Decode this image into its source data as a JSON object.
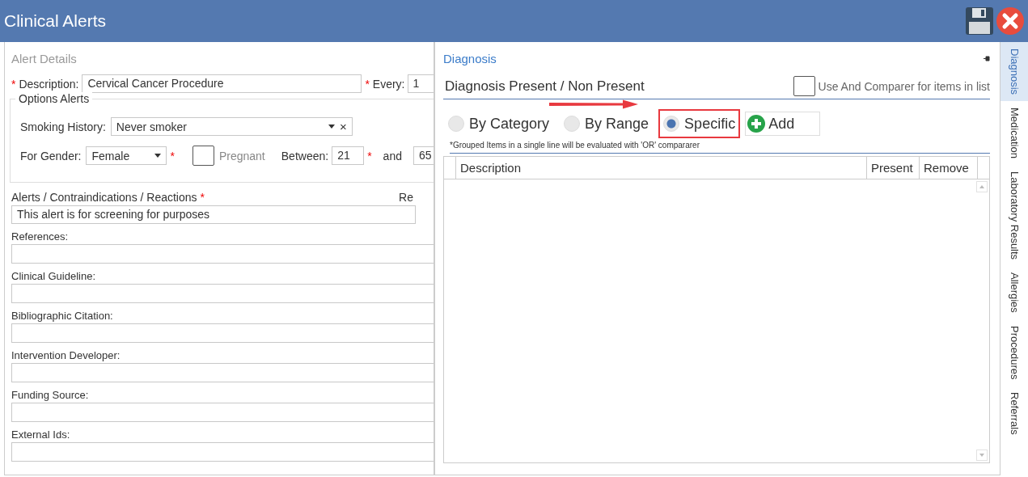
{
  "window": {
    "title": "Clinical Alerts"
  },
  "alert_details": {
    "title": "Alert Details",
    "description": {
      "marker": "*",
      "label": "Description:",
      "value": "Cervical Cancer Procedure"
    },
    "every": {
      "marker": "*",
      "label": "Every:",
      "value": "1"
    },
    "options_alerts": {
      "title": "Options Alerts",
      "smoking_history": {
        "label": "Smoking History:",
        "value": "Never smoker",
        "clear": "×"
      },
      "gender": {
        "label": "For Gender:",
        "value": "Female",
        "marker": "*"
      },
      "pregnant": {
        "label": "Pregnant",
        "checked": false
      },
      "between": {
        "label": "Between:",
        "value": "21",
        "marker": "*"
      },
      "and": {
        "label": "and",
        "value": "65"
      }
    },
    "alerts": {
      "label": "Alerts / Contraindications / Reactions",
      "marker": "*",
      "value": "This alert is for screening for purposes",
      "side_label": "Re"
    },
    "text_fields": [
      {
        "label": "References:"
      },
      {
        "label": "Clinical Guideline:"
      },
      {
        "label": "Bibliographic Citation:"
      },
      {
        "label": "Intervention Developer:"
      },
      {
        "label": "Funding Source:"
      },
      {
        "label": "External Ids:"
      }
    ]
  },
  "diagnosis": {
    "title": "Diagnosis",
    "section_title": "Diagnosis Present / Non Present",
    "use_and_comparer": {
      "label": "Use And Comparer for items in list",
      "checked": false
    },
    "radios": [
      {
        "label": "By Category",
        "selected": false,
        "highlighted": false
      },
      {
        "label": "By Range",
        "selected": false,
        "highlighted": false
      },
      {
        "label": "Specific",
        "selected": true,
        "highlighted": true
      }
    ],
    "add_button": "Add",
    "note": "*Grouped Items in a single line will be evaluated with 'OR' compararer",
    "table": {
      "columns": [
        "Description",
        "Present",
        "Remove"
      ]
    }
  },
  "vertical_tabs": [
    {
      "label": "Diagnosis",
      "selected": true
    },
    {
      "label": "Medication",
      "selected": false
    },
    {
      "label": "Laboratory Results",
      "selected": false
    },
    {
      "label": "Allergies",
      "selected": false
    },
    {
      "label": "Procedures",
      "selected": false
    },
    {
      "label": "Referrals",
      "selected": false
    }
  ]
}
